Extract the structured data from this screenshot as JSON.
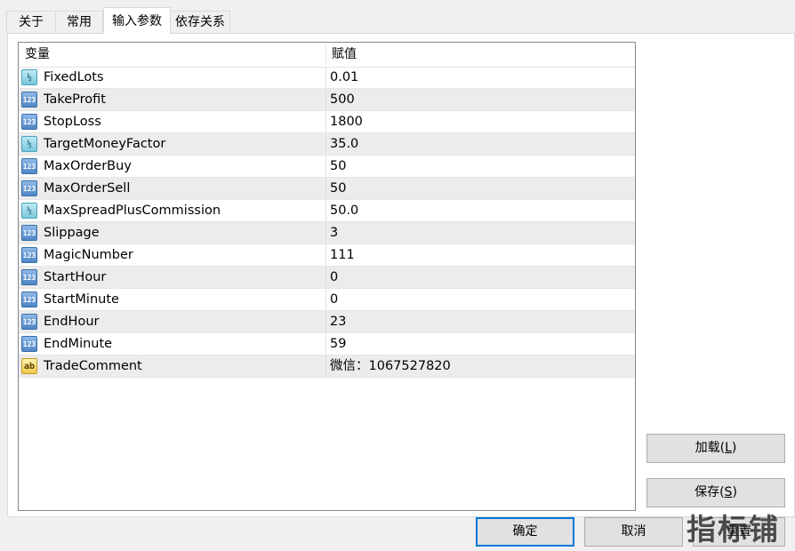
{
  "tabs": [
    {
      "label": "关于"
    },
    {
      "label": "常用"
    },
    {
      "label": "输入参数"
    },
    {
      "label": "依存关系"
    }
  ],
  "active_tab": "输入参数",
  "grid": {
    "columns": {
      "variable": "变量",
      "value": "赋值"
    },
    "rows": [
      {
        "name": "FixedLots",
        "value": "0.01",
        "type_icon": "double-icon"
      },
      {
        "name": "TakeProfit",
        "value": "500",
        "type_icon": "integer-icon"
      },
      {
        "name": "StopLoss",
        "value": "1800",
        "type_icon": "integer-icon"
      },
      {
        "name": "TargetMoneyFactor",
        "value": "35.0",
        "type_icon": "double-icon"
      },
      {
        "name": "MaxOrderBuy",
        "value": "50",
        "type_icon": "integer-icon"
      },
      {
        "name": "MaxOrderSell",
        "value": "50",
        "type_icon": "integer-icon"
      },
      {
        "name": "MaxSpreadPlusCommission",
        "value": "50.0",
        "type_icon": "double-icon"
      },
      {
        "name": "Slippage",
        "value": "3",
        "type_icon": "integer-icon"
      },
      {
        "name": "MagicNumber",
        "value": "111",
        "type_icon": "integer-icon"
      },
      {
        "name": "StartHour",
        "value": "0",
        "type_icon": "integer-icon"
      },
      {
        "name": "StartMinute",
        "value": "0",
        "type_icon": "integer-icon"
      },
      {
        "name": "EndHour",
        "value": "23",
        "type_icon": "integer-icon"
      },
      {
        "name": "EndMinute",
        "value": "59",
        "type_icon": "integer-icon"
      },
      {
        "name": "TradeComment",
        "value": "微信：1067527820",
        "type_icon": "string-icon"
      }
    ]
  },
  "icon_glyphs": {
    "integer-icon": "123",
    "double-icon": "½",
    "string-icon": "ab"
  },
  "buttons": {
    "load": {
      "label": "加载(",
      "accel": "L",
      "suffix": ")"
    },
    "save": {
      "label": "保存(",
      "accel": "S",
      "suffix": ")"
    },
    "ok": "确定",
    "cancel": "取消",
    "reset": "重置"
  },
  "watermark": "指标铺",
  "colors": {
    "default_button_border": "#0078d7",
    "alt_row": "#ececec",
    "panel": "#ffffff",
    "window": "#f0f0f0"
  }
}
